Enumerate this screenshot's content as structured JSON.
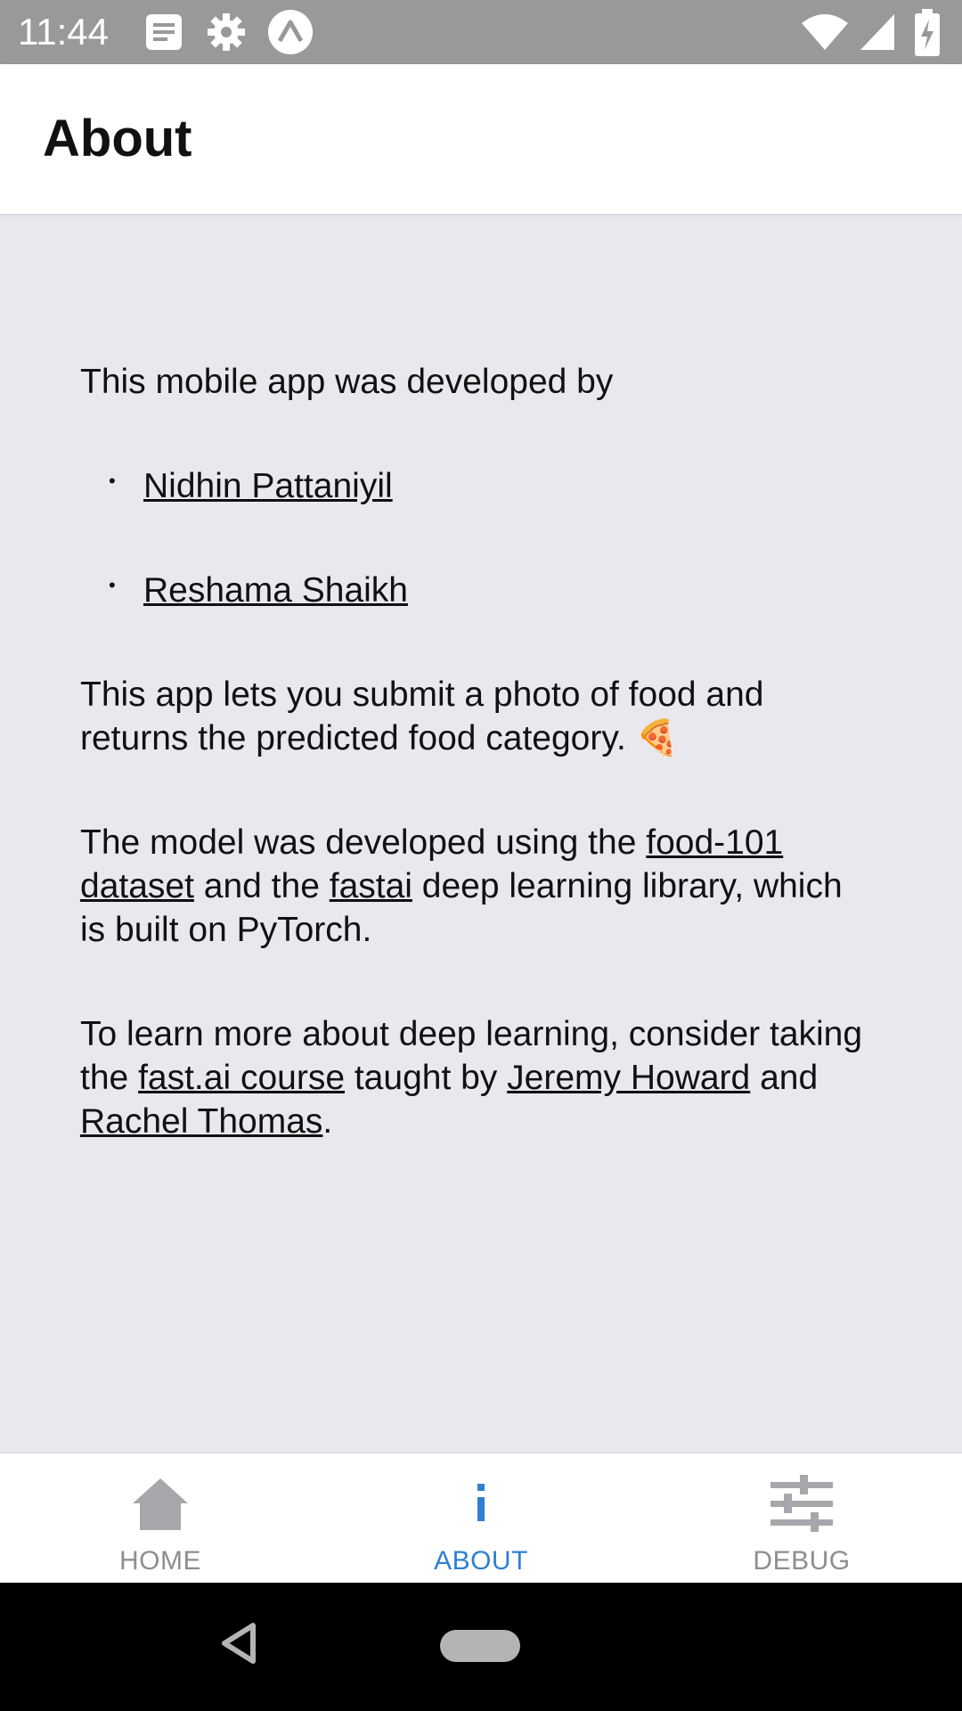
{
  "status_bar": {
    "time": "11:44",
    "icons": [
      "notification-icon",
      "settings-icon",
      "expo-icon",
      "wifi-icon",
      "signal-icon",
      "battery-charging-icon"
    ]
  },
  "header": {
    "title": "About"
  },
  "about": {
    "intro": "This mobile app was developed by",
    "authors": [
      {
        "name": "Nidhin Pattaniyil"
      },
      {
        "name": "Reshama Shaikh"
      }
    ],
    "description": "This app lets you submit a photo of food and returns the predicted food category.",
    "description_emoji": "🍕",
    "model": {
      "text_1": "The model was developed using the ",
      "link_food101": "food-101 dataset",
      "text_2": " and the ",
      "link_fastai": "fastai",
      "text_3": " deep learning library, which is built on PyTorch."
    },
    "learn": {
      "text_1": "To learn more about deep learning, consider taking the ",
      "link_course": "fast.ai course",
      "text_2": " taught by ",
      "link_jeremy": "Jeremy Howard",
      "text_3": " and ",
      "link_rachel": "Rachel Thomas",
      "text_4": "."
    }
  },
  "tab_bar": {
    "tabs": [
      {
        "label": "HOME",
        "icon": "home-icon",
        "active": false
      },
      {
        "label": "ABOUT",
        "icon": "info-icon",
        "active": true
      },
      {
        "label": "DEBUG",
        "icon": "sliders-icon",
        "active": false
      }
    ],
    "active_color": "#2f80d1",
    "inactive_color": "#8e8e93"
  },
  "nav_bar": {
    "icons": [
      "back-icon",
      "home-pill-icon"
    ]
  }
}
